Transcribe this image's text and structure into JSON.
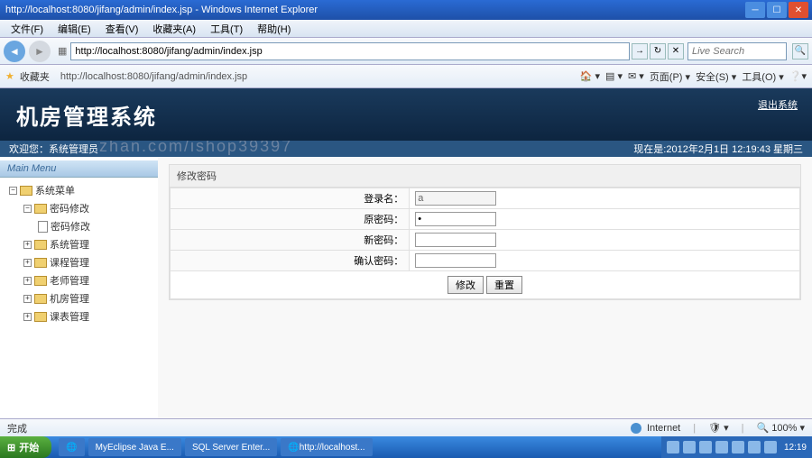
{
  "window": {
    "title": "http://localhost:8080/jifang/admin/index.jsp - Windows Internet Explorer"
  },
  "menubar": {
    "items": [
      "文件(F)",
      "编辑(E)",
      "查看(V)",
      "收藏夹(A)",
      "工具(T)",
      "帮助(H)"
    ]
  },
  "nav": {
    "url": "http://localhost:8080/jifang/admin/index.jsp",
    "search_placeholder": "Live Search"
  },
  "toolbar2": {
    "fav_label": "收藏夹",
    "fav_url": "http://localhost:8080/jifang/admin/index.jsp",
    "page_btn": "页面(P)",
    "safety_btn": "安全(S)",
    "tools_btn": "工具(O)"
  },
  "watermark": "zhan.com/ishop39397",
  "app": {
    "title": "机房管理系统",
    "logout": "退出系统",
    "welcome": "欢迎您：系统管理员",
    "datetime": "现在是:2012年2月1日 12:19:43 星期三"
  },
  "sidebar": {
    "header": "Main Menu",
    "root": "系统菜单",
    "pwd_group": "密码修改",
    "pwd_item": "密码修改",
    "items": [
      "系统管理",
      "课程管理",
      "老师管理",
      "机房管理",
      "课表管理"
    ]
  },
  "form": {
    "panel_title": "修改密码",
    "login_label": "登录名：",
    "login_value": "a",
    "old_pwd_label": "原密码：",
    "old_pwd_value": "•",
    "new_pwd_label": "新密码：",
    "confirm_label": "确认密码：",
    "submit": "修改",
    "reset": "重置"
  },
  "status": {
    "done": "完成",
    "zone": "Internet",
    "zoom": "100%"
  },
  "taskbar": {
    "start": "开始",
    "items": [
      "MyEclipse Java E...",
      "SQL Server Enter...",
      "http://localhost..."
    ],
    "clock": "12:19"
  }
}
